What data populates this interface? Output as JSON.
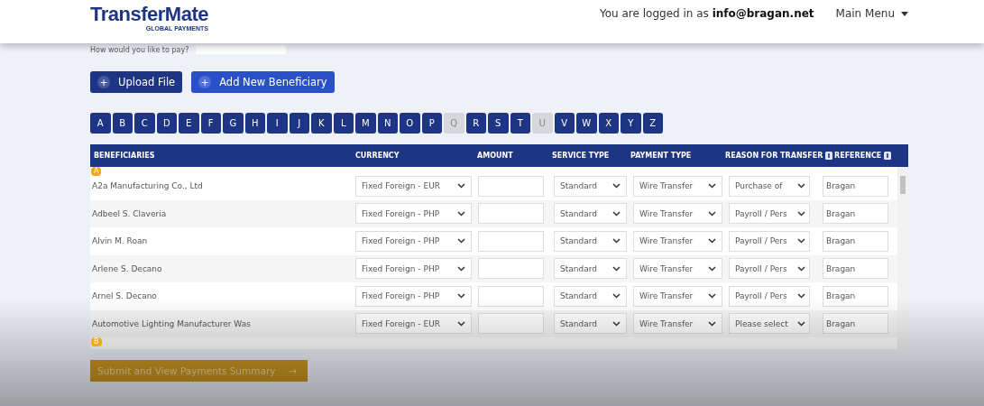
{
  "header": {
    "logo": "TransferMate",
    "logo_sub": "GLOBAL PAYMENTS",
    "login_text": "You are logged in as",
    "login_email": "info@bragan.net",
    "menu": "Main Menu"
  },
  "pay": {
    "label": "How would you like to pay?"
  },
  "actions": [
    {
      "icon": "+",
      "label": "Upload File",
      "kind": "dark"
    },
    {
      "icon": "+",
      "label": "Add New Beneficiary",
      "kind": "bright"
    }
  ],
  "letters": [
    {
      "label": "A",
      "disabled": false
    },
    {
      "label": "B",
      "disabled": false
    },
    {
      "label": "C",
      "disabled": false
    },
    {
      "label": "D",
      "disabled": false
    },
    {
      "label": "E",
      "disabled": false
    },
    {
      "label": "F",
      "disabled": false
    },
    {
      "label": "G",
      "disabled": false
    },
    {
      "label": "H",
      "disabled": false
    },
    {
      "label": "I",
      "disabled": false
    },
    {
      "label": "J",
      "disabled": false
    },
    {
      "label": "K",
      "disabled": false
    },
    {
      "label": "L",
      "disabled": false
    },
    {
      "label": "M",
      "disabled": false
    },
    {
      "label": "N",
      "disabled": false
    },
    {
      "label": "O",
      "disabled": false
    },
    {
      "label": "P",
      "disabled": false
    },
    {
      "label": "Q",
      "disabled": true
    },
    {
      "label": "R",
      "disabled": false
    },
    {
      "label": "S",
      "disabled": false
    },
    {
      "label": "T",
      "disabled": false
    },
    {
      "label": "U",
      "disabled": true
    },
    {
      "label": "V",
      "disabled": false
    },
    {
      "label": "W",
      "disabled": false
    },
    {
      "label": "X",
      "disabled": false
    },
    {
      "label": "Y",
      "disabled": false
    },
    {
      "label": "Z",
      "disabled": false
    }
  ],
  "table": {
    "columns": [
      {
        "label": "BENEFICIARIES",
        "info": false
      },
      {
        "label": "CURRENCY",
        "info": false
      },
      {
        "label": "AMOUNT",
        "info": false
      },
      {
        "label": "SERVICE TYPE",
        "info": false
      },
      {
        "label": "PAYMENT TYPE",
        "info": false
      },
      {
        "label": "REASON FOR TRANSFER",
        "info": true
      },
      {
        "label": "REFERENCE",
        "info": true
      }
    ],
    "groups": [
      {
        "letter": "A",
        "rows": [
          {
            "name": "A2a Manufacturing Co., Ltd",
            "currency": "Fixed Foreign - EUR",
            "service": "Standard",
            "payment": "Wire Transfer",
            "reason": "Purchase of",
            "reference": "Bragan"
          },
          {
            "name": "Adbeel S. Claveria",
            "currency": "Fixed Foreign - PHP",
            "service": "Standard",
            "payment": "Wire Transfer",
            "reason": "Payroll / Pers",
            "reference": "Bragan"
          },
          {
            "name": "Alvin M. Roan",
            "currency": "Fixed Foreign - PHP",
            "service": "Standard",
            "payment": "Wire Transfer",
            "reason": "Payroll / Pers",
            "reference": "Bragan"
          },
          {
            "name": "Arlene S. Decano",
            "currency": "Fixed Foreign - PHP",
            "service": "Standard",
            "payment": "Wire Transfer",
            "reason": "Payroll / Pers",
            "reference": "Bragan"
          },
          {
            "name": "Arnel S. Decano",
            "currency": "Fixed Foreign - PHP",
            "service": "Standard",
            "payment": "Wire Transfer",
            "reason": "Payroll / Pers",
            "reference": "Bragan"
          },
          {
            "name": "Automotive Lighting Manufacturer Was",
            "currency": "Fixed Foreign - EUR",
            "service": "Standard",
            "payment": "Wire Transfer",
            "reason": "Please select",
            "reference": "Bragan"
          }
        ]
      },
      {
        "letter": "B"
      }
    ]
  },
  "submit": {
    "label": "Submit and View Payments Summary",
    "icon": "→"
  }
}
